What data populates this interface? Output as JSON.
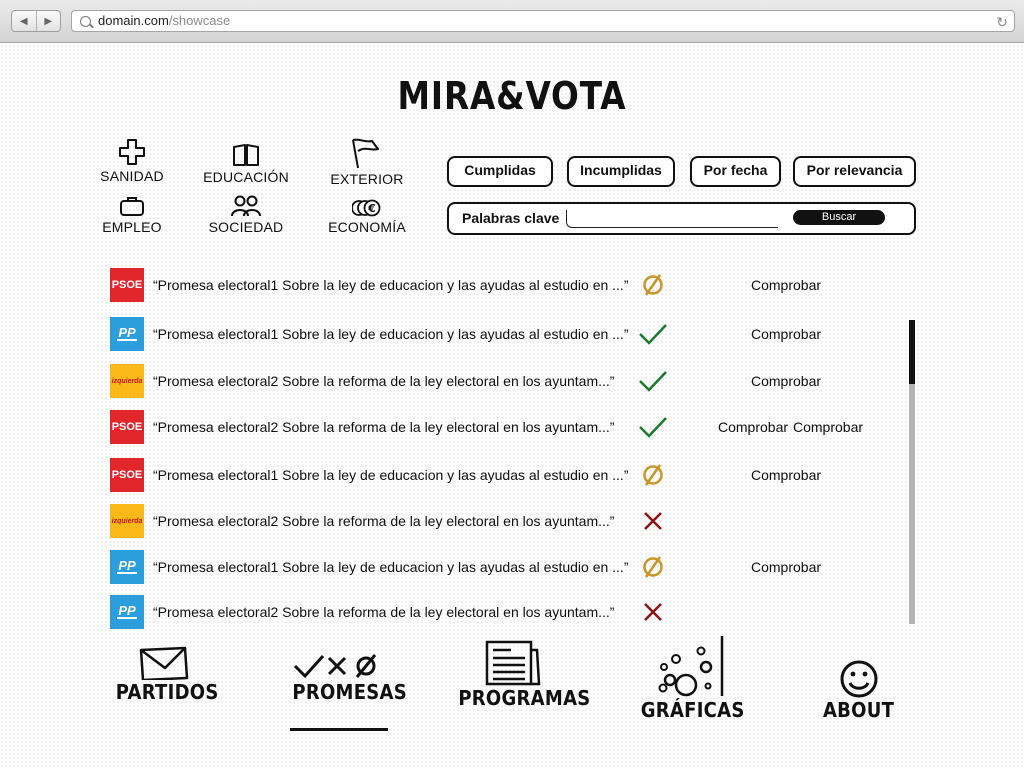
{
  "browser": {
    "url_domain": "domain.com",
    "url_path": "/showcase"
  },
  "logo": "MIRA&VOTA",
  "categories": [
    {
      "label": "SANIDAD",
      "icon": "plus-icon"
    },
    {
      "label": "EDUCACIÓN",
      "icon": "book-icon"
    },
    {
      "label": "EXTERIOR",
      "icon": "flag-icon"
    },
    {
      "label": "EMPLEO",
      "icon": "briefcase-icon"
    },
    {
      "label": "SOCIEDAD",
      "icon": "people-icon"
    },
    {
      "label": "ECONOMÍA",
      "icon": "coins-icon"
    }
  ],
  "filters": [
    "Cumplidas",
    "Incumplidas",
    "Por fecha",
    "Por relevancia"
  ],
  "search": {
    "label": "Palabras clave",
    "placeholder": "",
    "button": "Buscar"
  },
  "promises": [
    {
      "party": "PSOE",
      "text": "“Promesa  electoral1 Sobre la ley de educacion y las ayudas al estudio  en ...”",
      "status": "pending",
      "links": [
        "Comprobar"
      ]
    },
    {
      "party": "PP",
      "text": "“Promesa  electoral1 Sobre la ley de educacion y las ayudas al estudio  en ...”",
      "status": "fulfilled",
      "links": [
        "Comprobar"
      ]
    },
    {
      "party": "izquierda",
      "text": "“Promesa  electoral2 Sobre la reforma de la ley electoral en los ayuntam...”",
      "status": "fulfilled",
      "links": [
        "Comprobar"
      ]
    },
    {
      "party": "PSOE",
      "text": "“Promesa  electoral2 Sobre la reforma de la ley electoral en los ayuntam...”",
      "status": "fulfilled",
      "links": [
        "Comprobar",
        "Comprobar"
      ]
    },
    {
      "party": "PSOE",
      "text": "“Promesa  electoral1 Sobre la ley de educacion y las ayudas al estudio  en ...”",
      "status": "pending",
      "links": [
        "Comprobar"
      ]
    },
    {
      "party": "izquierda",
      "text": "“Promesa  electoral2 Sobre la reforma de la ley electoral en los ayuntam...”",
      "status": "broken",
      "links": []
    },
    {
      "party": "PP",
      "text": "“Promesa  electoral1 Sobre la ley de educacion y las ayudas al estudio  en ...”",
      "status": "pending",
      "links": [
        "Comprobar"
      ]
    },
    {
      "party": "PP",
      "text": "“Promesa  electoral2 Sobre la reforma de la ley electoral en los ayuntam...”",
      "status": "broken",
      "links": []
    }
  ],
  "nav": [
    {
      "label": "PARTIDOS",
      "icon": "envelope-icon",
      "active": false
    },
    {
      "label": "PROMESAS",
      "icon": "check-cross-null-icon",
      "active": true
    },
    {
      "label": "PROGRAMAS",
      "icon": "document-icon",
      "active": false
    },
    {
      "label": "GRÁFICAS",
      "icon": "bubble-chart-icon",
      "active": false
    },
    {
      "label": "ABOUT",
      "icon": "smiley-icon",
      "active": false
    }
  ],
  "colors": {
    "psoe": "#e2272c",
    "pp": "#2b9fde",
    "izquierda": "#fbb819",
    "fulfilled": "#1b7a2e",
    "broken": "#8e1515",
    "pending": "#c8962a"
  }
}
